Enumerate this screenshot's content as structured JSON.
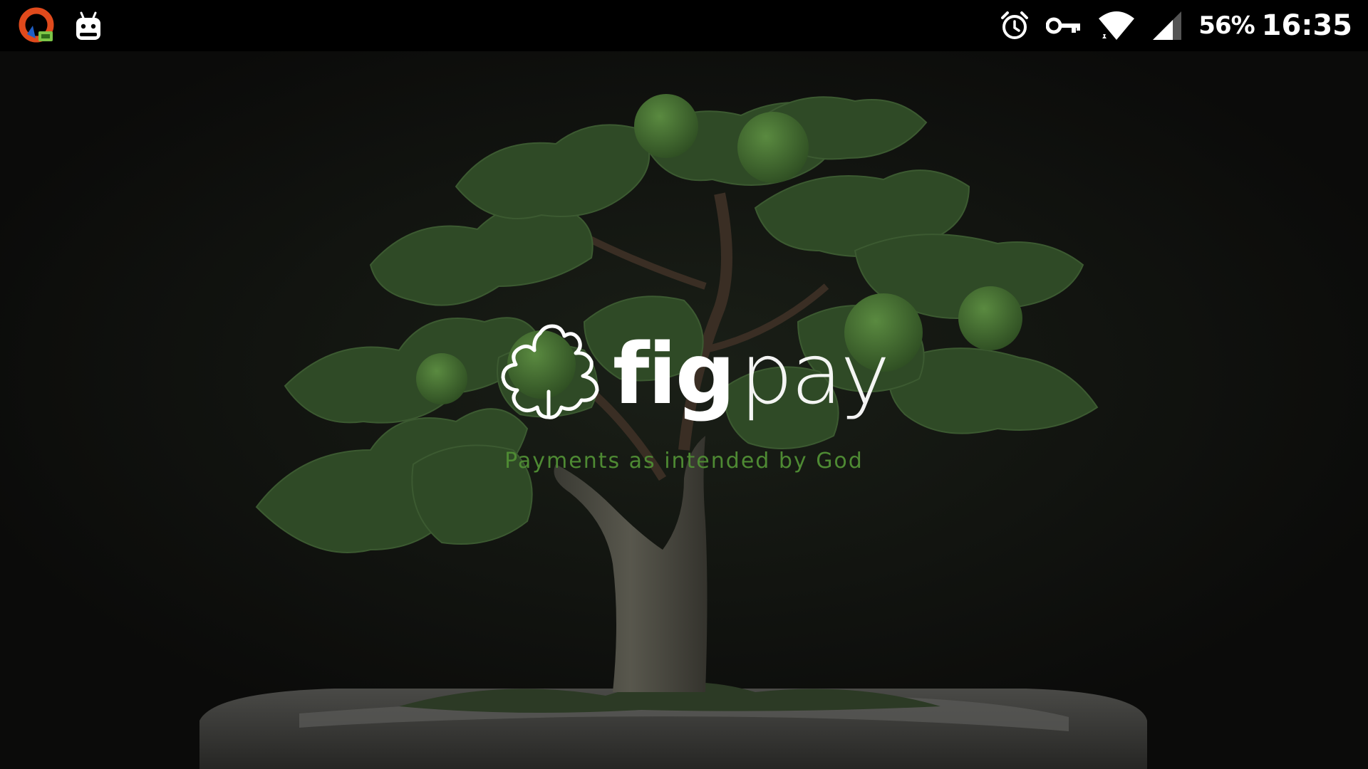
{
  "status_bar": {
    "left_icons": [
      "opera-vpn-app-icon",
      "android-robot-icon"
    ],
    "right_icons": [
      "alarm-clock-icon",
      "vpn-key-icon",
      "wifi-icon",
      "cell-signal-icon"
    ],
    "battery": "56%",
    "time": "16:35"
  },
  "splash": {
    "logo_icon": "fig-leaf-icon",
    "brand_bold": "fig",
    "brand_light": "pay",
    "tagline": "Payments as intended by God"
  },
  "colors": {
    "background": "#0c0c0c",
    "leaf": "#2d4a24",
    "fruit": "#4c7a35",
    "tagline": "#4e8a33",
    "brand_text": "#ffffff"
  }
}
